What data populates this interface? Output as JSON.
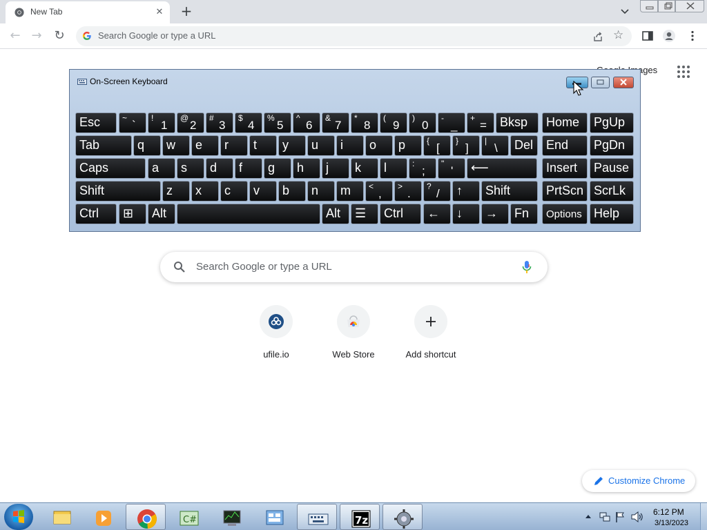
{
  "browser": {
    "tab_title": "New Tab",
    "omnibox_placeholder": "Search Google or type a URL",
    "accent_color": "#1a73e8"
  },
  "ntp": {
    "top_link": "Google Images",
    "search_placeholder": "Search Google or type a URL",
    "shortcuts": [
      {
        "label": "ufile.io",
        "icon": "ufile-icon"
      },
      {
        "label": "Web Store",
        "icon": "web-store-icon"
      },
      {
        "label": "Add shortcut",
        "icon": "plus-icon"
      }
    ],
    "customize_label": "Customize Chrome"
  },
  "osk": {
    "title": "On-Screen Keyboard",
    "rows": [
      [
        {
          "m": "Esc"
        },
        {
          "s": "~",
          "u": "`"
        },
        {
          "s": "!",
          "u": "1"
        },
        {
          "s": "@",
          "u": "2"
        },
        {
          "s": "#",
          "u": "3"
        },
        {
          "s": "$",
          "u": "4"
        },
        {
          "s": "%",
          "u": "5"
        },
        {
          "s": "^",
          "u": "6"
        },
        {
          "s": "&",
          "u": "7"
        },
        {
          "s": "*",
          "u": "8"
        },
        {
          "s": "(",
          "u": "9"
        },
        {
          "s": ")",
          "u": "0"
        },
        {
          "s": "-",
          "u": "_"
        },
        {
          "s": "+",
          "u": "="
        },
        {
          "m": "Bksp"
        },
        {
          "m": "Home"
        },
        {
          "m": "PgUp"
        }
      ],
      [
        {
          "m": "Tab"
        },
        {
          "m": "q"
        },
        {
          "m": "w"
        },
        {
          "m": "e"
        },
        {
          "m": "r"
        },
        {
          "m": "t"
        },
        {
          "m": "y"
        },
        {
          "m": "u"
        },
        {
          "m": "i"
        },
        {
          "m": "o"
        },
        {
          "m": "p"
        },
        {
          "s": "{",
          "u": "["
        },
        {
          "s": "}",
          "u": "]"
        },
        {
          "s": "|",
          "u": "\\"
        },
        {
          "m": "Del"
        },
        {
          "m": "End"
        },
        {
          "m": "PgDn"
        }
      ],
      [
        {
          "m": "Caps"
        },
        {
          "m": "a"
        },
        {
          "m": "s"
        },
        {
          "m": "d"
        },
        {
          "m": "f"
        },
        {
          "m": "g"
        },
        {
          "m": "h"
        },
        {
          "m": "j"
        },
        {
          "m": "k"
        },
        {
          "m": "l"
        },
        {
          "s": ":",
          "u": ";"
        },
        {
          "s": "\"",
          "u": "'"
        },
        {
          "m": "⟵"
        },
        {
          "m": "Insert"
        },
        {
          "m": "Pause"
        }
      ],
      [
        {
          "m": "Shift"
        },
        {
          "m": "z"
        },
        {
          "m": "x"
        },
        {
          "m": "c"
        },
        {
          "m": "v"
        },
        {
          "m": "b"
        },
        {
          "m": "n"
        },
        {
          "m": "m"
        },
        {
          "s": "<",
          "u": ","
        },
        {
          "s": ">",
          "u": "."
        },
        {
          "s": "?",
          "u": "/"
        },
        {
          "m": "↑"
        },
        {
          "m": "Shift"
        },
        {
          "m": "PrtScn"
        },
        {
          "m": "ScrLk"
        }
      ],
      [
        {
          "m": "Ctrl"
        },
        {
          "m": "⊞"
        },
        {
          "m": "Alt"
        },
        {
          "m": ""
        },
        {
          "m": "Alt"
        },
        {
          "m": "☰"
        },
        {
          "m": "Ctrl"
        },
        {
          "m": "←"
        },
        {
          "m": "↓"
        },
        {
          "m": "→"
        },
        {
          "m": "Fn"
        },
        {
          "m": "Options"
        },
        {
          "m": "Help"
        }
      ]
    ]
  },
  "taskbar": {
    "apps": [
      {
        "name": "explorer-icon"
      },
      {
        "name": "media-player-icon"
      },
      {
        "name": "chrome-icon"
      },
      {
        "name": "csharp-icon"
      },
      {
        "name": "task-manager-icon"
      },
      {
        "name": "control-panel-icon"
      },
      {
        "name": "on-screen-keyboard-icon"
      },
      {
        "name": "7zip-icon"
      },
      {
        "name": "settings-app-icon"
      }
    ],
    "time": "6:12 PM",
    "date": "3/13/2023"
  }
}
